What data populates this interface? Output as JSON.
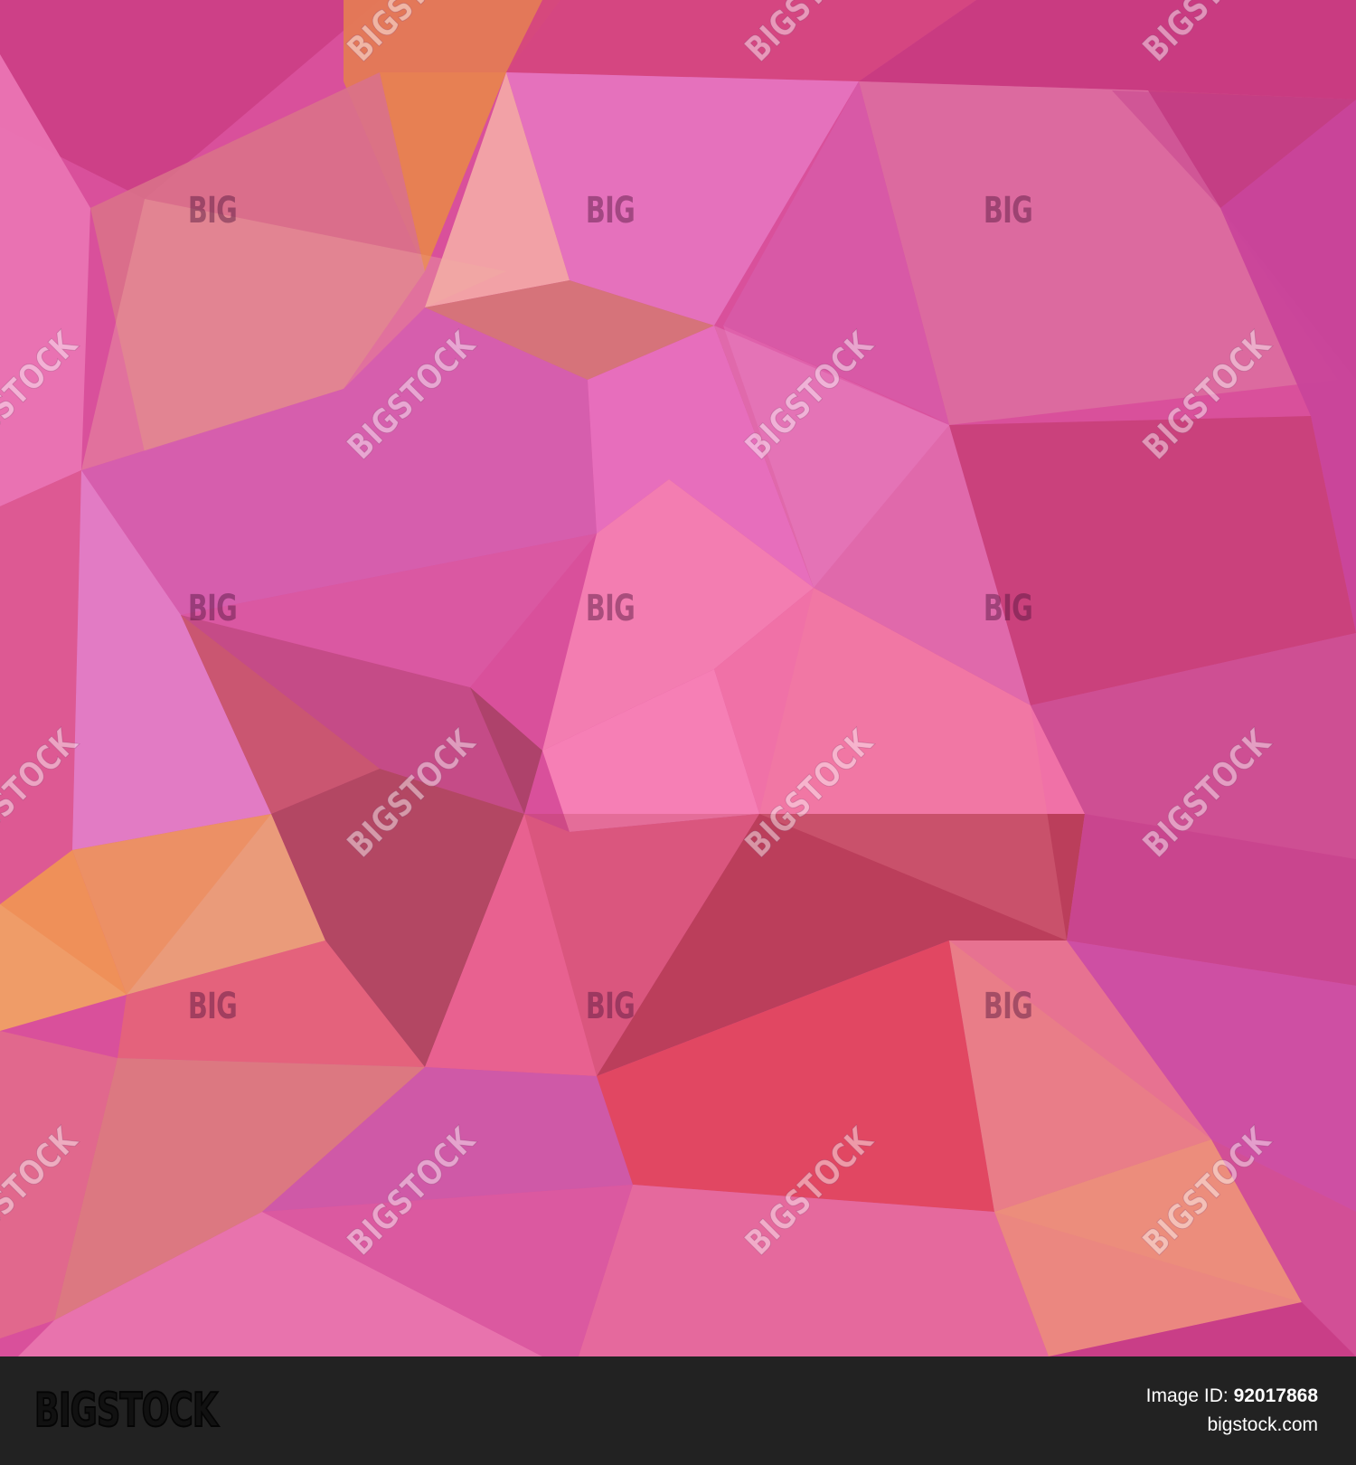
{
  "image": {
    "subject": "",
    "palette": [
      "#d23f85",
      "#e96cb6",
      "#f47eb0",
      "#e8744f",
      "#b63158",
      "#d357ab",
      "#f0a090"
    ]
  },
  "watermark": {
    "big_text": "BIG",
    "stock_text": "BIGSTOCK"
  },
  "footer": {
    "logo": "BIGSTOCK",
    "image_id_label": "Image ID:",
    "image_id_value": "92017868",
    "site": "bigstock.com"
  }
}
